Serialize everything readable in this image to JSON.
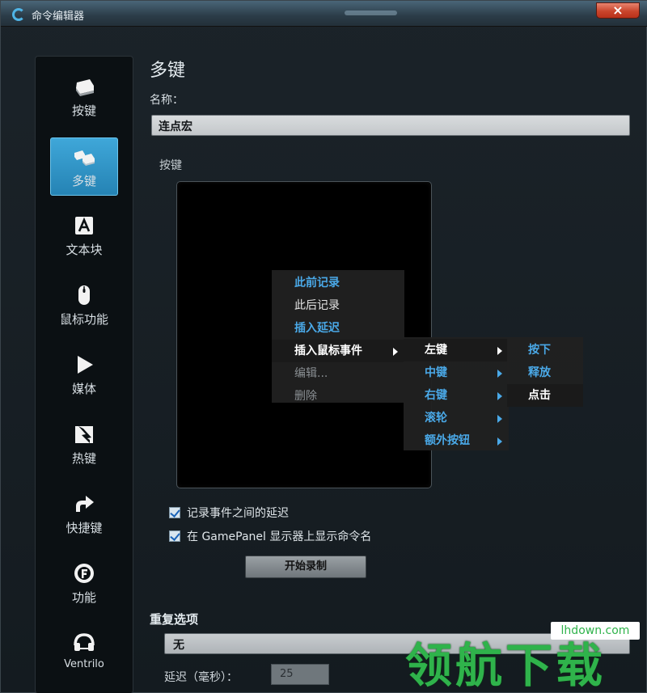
{
  "window": {
    "title": "命令编辑器",
    "close_label": "×"
  },
  "sidebar": {
    "items": [
      {
        "label": "按键",
        "icon": "key-icon"
      },
      {
        "label": "多键",
        "icon": "multi-key-icon",
        "active": true
      },
      {
        "label": "文本块",
        "icon": "text-block-icon"
      },
      {
        "label": "鼠标功能",
        "icon": "mouse-icon"
      },
      {
        "label": "媒体",
        "icon": "play-icon"
      },
      {
        "label": "热键",
        "icon": "hotkey-icon"
      },
      {
        "label": "快捷键",
        "icon": "shortcut-arrow-icon"
      },
      {
        "label": "功能",
        "icon": "function-icon"
      },
      {
        "label": "Ventrilo",
        "icon": "headset-icon"
      }
    ]
  },
  "main": {
    "heading": "多键",
    "name_label": "名称：",
    "name_value": "连点宏",
    "keys_label": "按键",
    "options": {
      "record_delay": "记录事件之间的延迟",
      "show_in_gamepanel": "在 GamePanel 显示器上显示命令名"
    },
    "record_button": "开始录制",
    "repeat": {
      "heading": "重复选项",
      "selected": "无",
      "delay_label": "延迟（毫秒）：",
      "delay_value": "25"
    }
  },
  "context_menu": {
    "items": [
      "此前记录",
      "此后记录",
      "插入延迟",
      "插入鼠标事件",
      "编辑...",
      "删除"
    ],
    "mouse_submenu": [
      "左键",
      "中键",
      "右键",
      "滚轮",
      "额外按钮"
    ],
    "action_submenu": [
      "按下",
      "释放",
      "点击"
    ]
  },
  "watermark": {
    "brand": "领航下载",
    "url": "lhdown.com"
  },
  "colors": {
    "accent": "#3fa7d9",
    "menu_blue": "#4aa9e8",
    "watermark_green": "#2fb34b"
  }
}
